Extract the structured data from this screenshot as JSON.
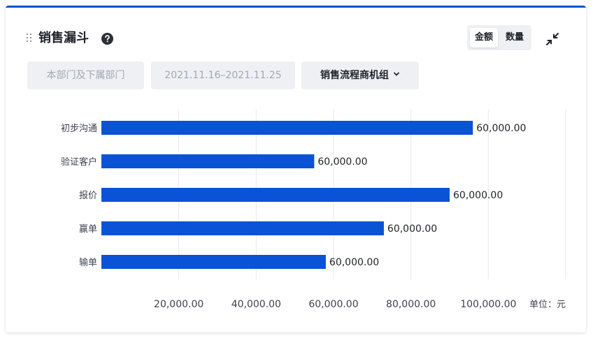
{
  "card": {
    "title": "销售漏斗",
    "accent_color": "#0a52d6"
  },
  "toggle": {
    "amount_label": "金额",
    "count_label": "数量",
    "active": "amount"
  },
  "filters": {
    "department": "本部门及下属部门",
    "date_range": "2021.11.16–2021.11.25",
    "group": "销售流程商机组"
  },
  "icons": {
    "drag": "drag-handle-icon",
    "help": "question-circle-icon",
    "collapse": "collapse-arrows-icon",
    "dropdown": "chevron-down-icon"
  },
  "chart_data": {
    "type": "bar",
    "orientation": "horizontal",
    "categories": [
      "初步沟通",
      "验证客户",
      "报价",
      "赢单",
      "输单"
    ],
    "values": [
      96000,
      55000,
      90000,
      73000,
      58000
    ],
    "data_labels": [
      "60,000.00",
      "60,000.00",
      "60,000.00",
      "60,000.00",
      "60,000.00"
    ],
    "x_ticks": [
      20000,
      40000,
      60000,
      80000,
      100000
    ],
    "x_tick_labels": [
      "20,000.00",
      "40,000.00",
      "60,000.00",
      "80,000.00",
      "100,000.00"
    ],
    "xlim": [
      0,
      120000
    ],
    "unit_label": "单位：元",
    "bar_color": "#0a52d6",
    "grid": true
  }
}
